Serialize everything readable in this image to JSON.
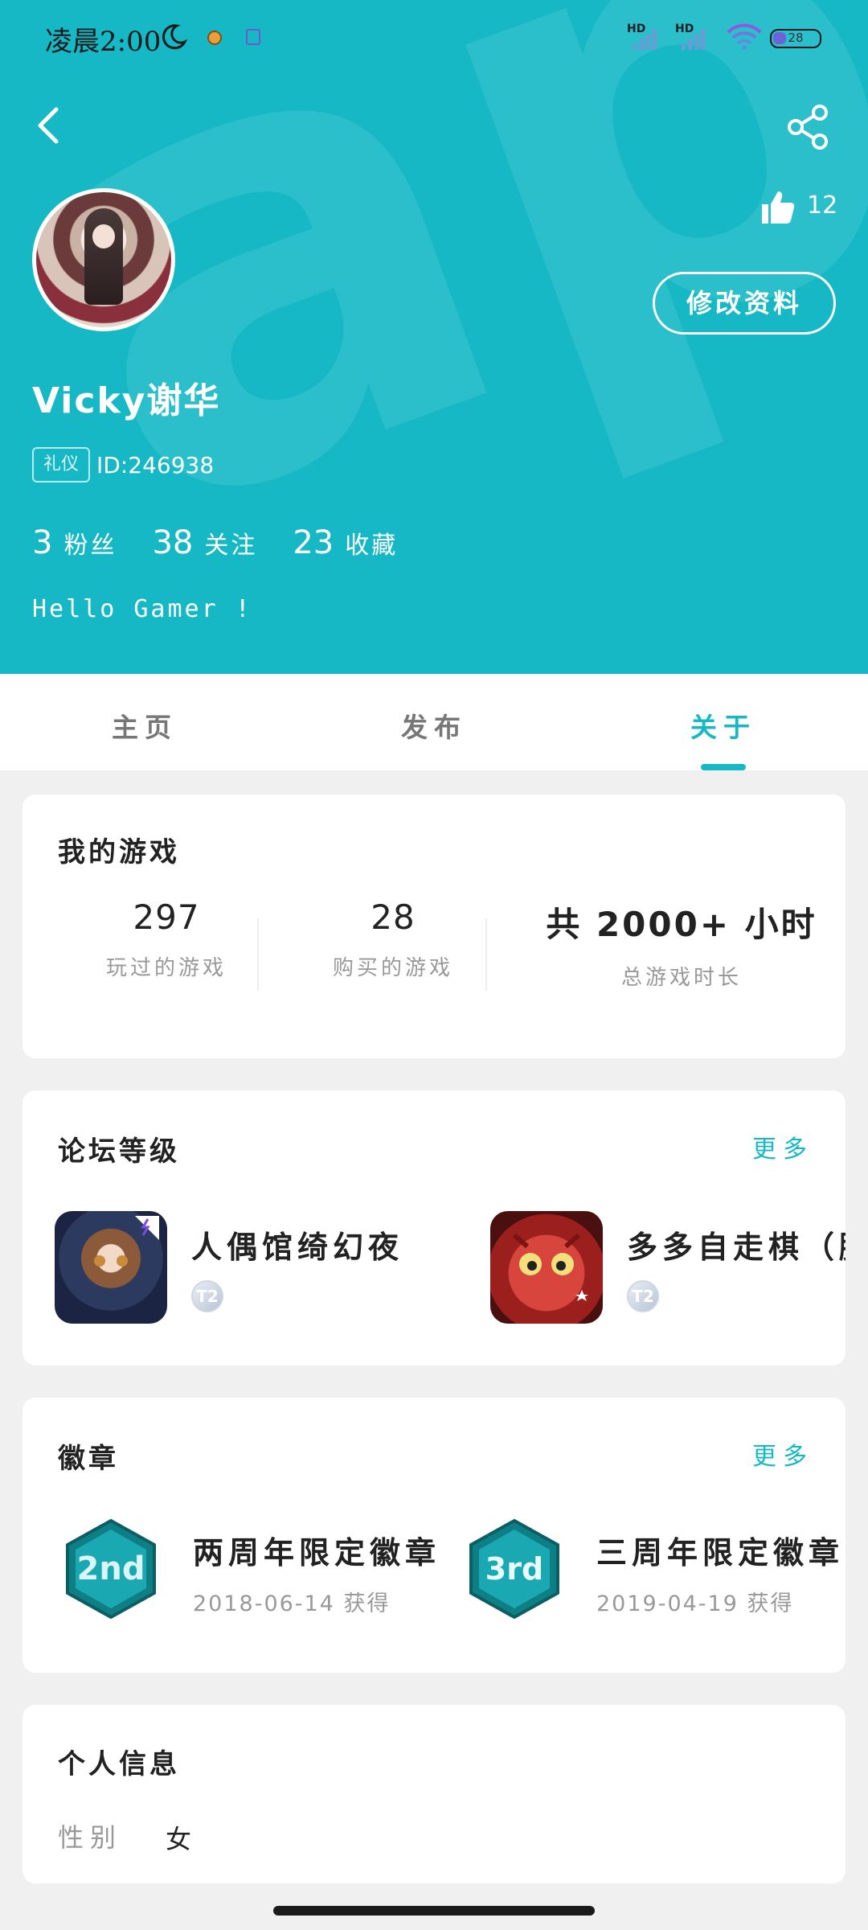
{
  "status_bar": {
    "time": "凌晨2:00",
    "battery": "28"
  },
  "profile": {
    "like_count": "12",
    "edit_button": "修改资料",
    "username": "Vicky谢华",
    "tag": "礼仪",
    "user_id": "ID:246938",
    "stats": [
      {
        "num": "3",
        "label": "粉丝"
      },
      {
        "num": "38",
        "label": "关注"
      },
      {
        "num": "23",
        "label": "收藏"
      }
    ],
    "bio": "Hello Gamer !"
  },
  "tabs": [
    "主页",
    "发布",
    "关于"
  ],
  "active_tab": "关于",
  "my_games": {
    "title": "我的游戏",
    "stats": [
      {
        "num": "297",
        "label": "玩过的游戏"
      },
      {
        "num": "28",
        "label": "购买的游戏"
      },
      {
        "num": "共 2000+ 小时",
        "label": "总游戏时长"
      }
    ]
  },
  "forum_level": {
    "title": "论坛等级",
    "more": "更多",
    "items": [
      {
        "name": "人偶馆绮幻夜",
        "level": "T2"
      },
      {
        "name": "多多自走棋（腾",
        "level": "T2"
      }
    ]
  },
  "badges": {
    "title": "徽章",
    "more": "更多",
    "items": [
      {
        "name": "两周年限定徽章",
        "date": "2018-06-14 获得",
        "mark": "2nd"
      },
      {
        "name": "三周年限定徽章",
        "date": "2019-04-19 获得",
        "mark": "3rd"
      }
    ]
  },
  "personal_info": {
    "title": "个人信息",
    "fields": [
      {
        "label": "性别",
        "value": "女"
      }
    ]
  },
  "colors": {
    "brand": "#16b8c6",
    "card_bg": "#ffffff",
    "page_bg": "#f0f0f0"
  }
}
